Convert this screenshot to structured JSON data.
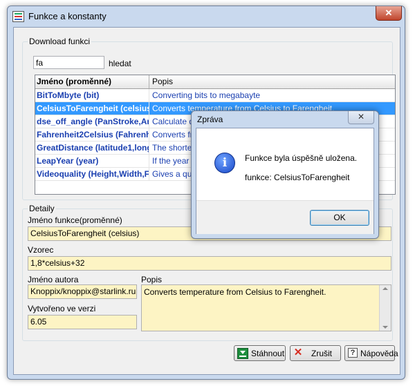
{
  "window": {
    "title": "Funkce a konstanty",
    "close_glyph": "✕"
  },
  "download": {
    "legend": "Download funkci",
    "search_value": "fa",
    "search_label": "hledat",
    "columns": {
      "name": "Jméno (proměnné)",
      "desc": "Popis"
    },
    "rows": [
      {
        "name": "BitToMbyte (bit)",
        "desc": "Converting bits to megabayte"
      },
      {
        "name": "CelsiusToFarengheit (celsius)",
        "desc": "Converts temperature from Celsius to Farengheit."
      },
      {
        "name": "dse_off_angle (PanStroke,An",
        "desc": "Calculate drive"
      },
      {
        "name": "Fahrenheit2Celsius (Fahrenhe",
        "desc": "Converts from"
      },
      {
        "name": "GreatDistance (latitude1,long",
        "desc": "The shortest"
      },
      {
        "name": "LeapYear (year)",
        "desc": "If the year er"
      },
      {
        "name": "Videoquality (Height,Width,Fr",
        "desc": "Gives a qualit"
      }
    ],
    "selected_row": 1
  },
  "detail": {
    "legend": "Detaily",
    "func_name_label": "Jméno funkce(proměnné)",
    "func_name_value": "CelsiusToFarengheit (celsius)",
    "formula_label": "Vzorec",
    "formula_value": "1,8*celsius+32",
    "author_label": "Jméno autora",
    "author_value": "Knoppix/knoppix@starlink.ru",
    "version_label": "Vytvořeno ve verzi",
    "version_value": "6.05",
    "desc_label": "Popis",
    "desc_value": "Converts temperature from Celsius to Farengheit."
  },
  "buttons": {
    "download": "Stáhnout",
    "cancel": "Zrušit",
    "help": "Nápověda"
  },
  "dialog": {
    "title": "Zpráva",
    "close_glyph": "✕",
    "icon_glyph": "i",
    "message": "Funkce byla úspěšně uložena.",
    "detail": "funkce: CelsiusToFarengheit",
    "ok_label": "OK"
  },
  "colors": {
    "selection": "#3399ff",
    "field_bg": "#fdf4c4",
    "link_text": "#1a3fb0"
  }
}
